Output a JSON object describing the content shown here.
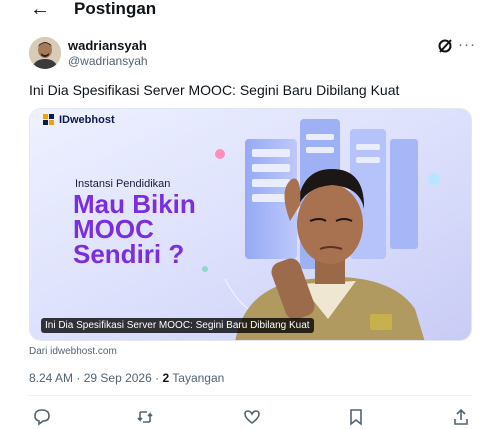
{
  "header": {
    "back_icon": "arrow-left-icon",
    "title": "Postingan"
  },
  "author": {
    "name": "wadriansyah",
    "handle": "@wadriansyah",
    "avatar_icon": "avatar"
  },
  "tweet": {
    "text": "Ini Dia Spesifikasi Server MOOC: Segini Baru Dibilang Kuat"
  },
  "card": {
    "brand": "IDwebhost",
    "subtitle": "Instansi Pendidikan",
    "headline_lines": [
      "Mau Bikin",
      "MOOC",
      "Sendiri ?"
    ],
    "caption": "Ini Dia Spesifikasi Server MOOC: Segini Baru Dibilang Kuat",
    "source": "Dari idwebhost.com"
  },
  "meta": {
    "time": "8.24 AM",
    "date": "29 Sep 2026",
    "separator": "·",
    "views": "2",
    "views_label": "Tayangan"
  },
  "actions": [
    "reply-icon",
    "retweet-icon",
    "like-icon",
    "bookmark-icon",
    "share-icon"
  ],
  "colors": {
    "text": "#0f1419",
    "secondary": "#536471",
    "headline": "#7b2ee0"
  }
}
